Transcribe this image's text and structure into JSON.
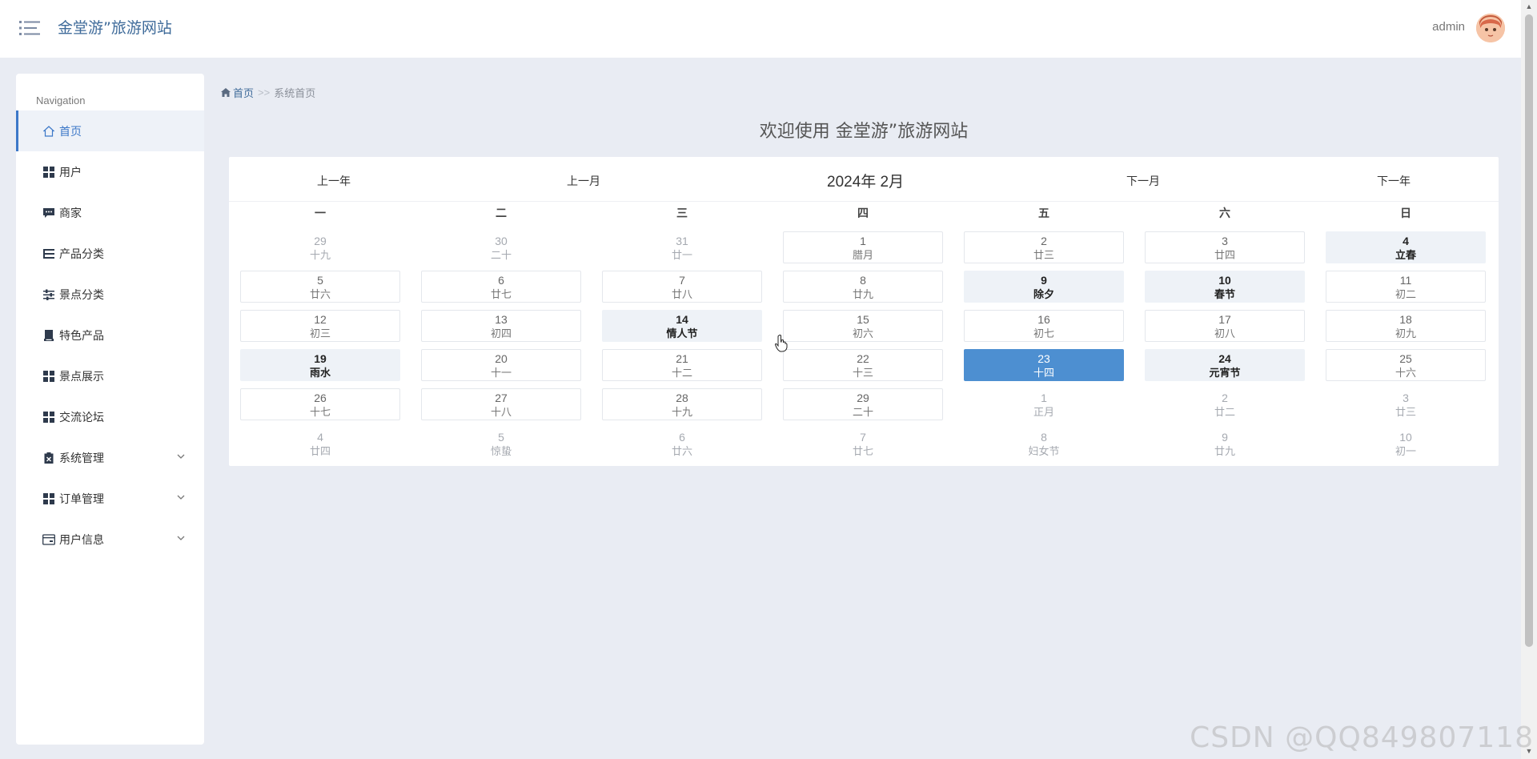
{
  "header": {
    "brand": "金堂游”旅游网站",
    "user": "admin"
  },
  "sidebar": {
    "title": "Navigation",
    "items": [
      {
        "label": "首页",
        "icon": "home-icon",
        "active": true,
        "expandable": false
      },
      {
        "label": "用户",
        "icon": "grid-icon",
        "active": false,
        "expandable": false
      },
      {
        "label": "商家",
        "icon": "chat-icon",
        "active": false,
        "expandable": false
      },
      {
        "label": "产品分类",
        "icon": "list-icon",
        "active": false,
        "expandable": false
      },
      {
        "label": "景点分类",
        "icon": "sliders-icon",
        "active": false,
        "expandable": false
      },
      {
        "label": "特色产品",
        "icon": "product-icon",
        "active": false,
        "expandable": false
      },
      {
        "label": "景点展示",
        "icon": "grid-icon",
        "active": false,
        "expandable": false
      },
      {
        "label": "交流论坛",
        "icon": "grid-icon",
        "active": false,
        "expandable": false
      },
      {
        "label": "系统管理",
        "icon": "clipboard-icon",
        "active": false,
        "expandable": true
      },
      {
        "label": "订单管理",
        "icon": "grid-icon",
        "active": false,
        "expandable": true
      },
      {
        "label": "用户信息",
        "icon": "card-icon",
        "active": false,
        "expandable": true
      }
    ]
  },
  "breadcrumb": {
    "home": "首页",
    "separator": ">>",
    "current": "系统首页"
  },
  "welcome": "欢迎使用 金堂游”旅游网站",
  "calendar": {
    "prev_year": "上一年",
    "prev_month": "上一月",
    "month_label": "2024年 2月",
    "next_month": "下一月",
    "next_year": "下一年",
    "weekdays": [
      "一",
      "二",
      "三",
      "四",
      "五",
      "六",
      "日"
    ],
    "weeks": [
      [
        {
          "day": "29",
          "lunar": "十九",
          "type": "other"
        },
        {
          "day": "30",
          "lunar": "二十",
          "type": "other"
        },
        {
          "day": "31",
          "lunar": "廿一",
          "type": "other"
        },
        {
          "day": "1",
          "lunar": "腊月",
          "type": "normal"
        },
        {
          "day": "2",
          "lunar": "廿三",
          "type": "normal"
        },
        {
          "day": "3",
          "lunar": "廿四",
          "type": "normal"
        },
        {
          "day": "4",
          "lunar": "立春",
          "type": "festival"
        }
      ],
      [
        {
          "day": "5",
          "lunar": "廿六",
          "type": "normal"
        },
        {
          "day": "6",
          "lunar": "廿七",
          "type": "normal"
        },
        {
          "day": "7",
          "lunar": "廿八",
          "type": "normal"
        },
        {
          "day": "8",
          "lunar": "廿九",
          "type": "normal"
        },
        {
          "day": "9",
          "lunar": "除夕",
          "type": "festival"
        },
        {
          "day": "10",
          "lunar": "春节",
          "type": "festival"
        },
        {
          "day": "11",
          "lunar": "初二",
          "type": "normal"
        }
      ],
      [
        {
          "day": "12",
          "lunar": "初三",
          "type": "normal"
        },
        {
          "day": "13",
          "lunar": "初四",
          "type": "normal"
        },
        {
          "day": "14",
          "lunar": "情人节",
          "type": "festival"
        },
        {
          "day": "15",
          "lunar": "初六",
          "type": "normal"
        },
        {
          "day": "16",
          "lunar": "初七",
          "type": "normal"
        },
        {
          "day": "17",
          "lunar": "初八",
          "type": "normal"
        },
        {
          "day": "18",
          "lunar": "初九",
          "type": "normal"
        }
      ],
      [
        {
          "day": "19",
          "lunar": "雨水",
          "type": "festival"
        },
        {
          "day": "20",
          "lunar": "十一",
          "type": "normal"
        },
        {
          "day": "21",
          "lunar": "十二",
          "type": "normal"
        },
        {
          "day": "22",
          "lunar": "十三",
          "type": "normal"
        },
        {
          "day": "23",
          "lunar": "十四",
          "type": "today"
        },
        {
          "day": "24",
          "lunar": "元宵节",
          "type": "festival"
        },
        {
          "day": "25",
          "lunar": "十六",
          "type": "normal"
        }
      ],
      [
        {
          "day": "26",
          "lunar": "十七",
          "type": "normal"
        },
        {
          "day": "27",
          "lunar": "十八",
          "type": "normal"
        },
        {
          "day": "28",
          "lunar": "十九",
          "type": "normal"
        },
        {
          "day": "29",
          "lunar": "二十",
          "type": "normal"
        },
        {
          "day": "1",
          "lunar": "正月",
          "type": "other"
        },
        {
          "day": "2",
          "lunar": "廿二",
          "type": "other"
        },
        {
          "day": "3",
          "lunar": "廿三",
          "type": "other"
        }
      ],
      [
        {
          "day": "4",
          "lunar": "廿四",
          "type": "other"
        },
        {
          "day": "5",
          "lunar": "惊蛰",
          "type": "other"
        },
        {
          "day": "6",
          "lunar": "廿六",
          "type": "other"
        },
        {
          "day": "7",
          "lunar": "廿七",
          "type": "other"
        },
        {
          "day": "8",
          "lunar": "妇女节",
          "type": "other"
        },
        {
          "day": "9",
          "lunar": "廿九",
          "type": "other"
        },
        {
          "day": "10",
          "lunar": "初一",
          "type": "other"
        }
      ]
    ]
  },
  "watermark": "CSDN @QQ849807118",
  "colors": {
    "accent": "#3c78c8",
    "today": "#4d8fd1",
    "brand": "#3f6b9a"
  }
}
